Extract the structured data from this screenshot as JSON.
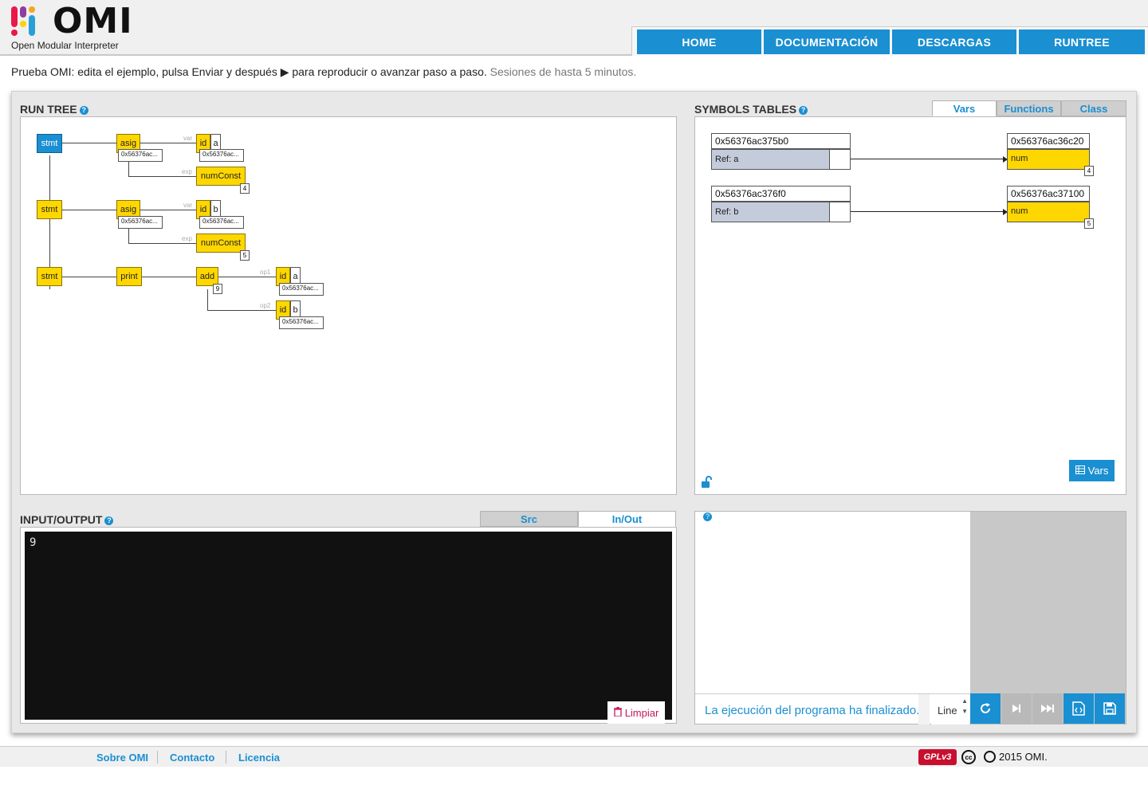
{
  "header": {
    "logo_word": "OMI",
    "logo_subtitle": "Open Modular Interpreter",
    "logo_colors": [
      "#e8194a",
      "#f5a623",
      "#2a9fd6",
      "#8b3fa0",
      "#ffd200"
    ],
    "nav": [
      "HOME",
      "DOCUMENTACIÓN",
      "DESCARGAS",
      "RUNTREE"
    ]
  },
  "intro": {
    "main": "Prueba OMI: edita el ejemplo, pulsa Enviar y después ▶ para reproducir o avanzar paso a paso.",
    "muted": "Sesiones de hasta 5 minutos."
  },
  "run_tree": {
    "title": "RUN TREE",
    "help": "?",
    "rows": [
      {
        "stmt": "stmt",
        "stmt_active": true,
        "op": "asig",
        "op_ref": "0x56376ac...",
        "var_label": "var",
        "id": "id",
        "id_name": "a",
        "id_ref": "0x56376ac...",
        "exp_label": "exp",
        "const": "numConst",
        "const_value": "4"
      },
      {
        "stmt": "stmt",
        "stmt_active": false,
        "op": "asig",
        "op_ref": "0x56376ac...",
        "var_label": "var",
        "id": "id",
        "id_name": "b",
        "id_ref": "0x56376ac...",
        "exp_label": "exp",
        "const": "numConst",
        "const_value": "5"
      }
    ],
    "print_row": {
      "stmt": "stmt",
      "print": "print",
      "add": "add",
      "add_value": "9",
      "op1_label": "op1",
      "op1_id": "id",
      "op1_name": "a",
      "op1_ref": "0x56376ac...",
      "op2_label": "op2",
      "op2_id": "id",
      "op2_name": "b",
      "op2_ref": "0x56376ac..."
    }
  },
  "symbols": {
    "title": "SYMBOLS TABLES",
    "help": "?",
    "tabs": [
      "Vars",
      "Functions",
      "Class"
    ],
    "active_tab": "Vars",
    "entries": [
      {
        "address": "0x56376ac375b0",
        "ref": "Ref: a",
        "target_address": "0x56376ac36c20",
        "type": "num",
        "value": "4"
      },
      {
        "address": "0x56376ac376f0",
        "ref": "Ref: b",
        "target_address": "0x56376ac37100",
        "type": "num",
        "value": "5"
      }
    ],
    "vars_button": "Vars",
    "lock_icon": "unlock-icon"
  },
  "io": {
    "title": "INPUT/OUTPUT",
    "help": "?",
    "tabs": [
      "Src",
      "In/Out"
    ],
    "active_tab": "In/Out",
    "output": "9",
    "clear_button": "Limpiar"
  },
  "debug": {
    "help": "?",
    "status": "La ejecución del programa ha finalizado.",
    "select_value": "Line",
    "controls": [
      {
        "icon": "reload-icon",
        "color": "blue"
      },
      {
        "icon": "step-icon",
        "color": "gray"
      },
      {
        "icon": "fast-forward-icon",
        "color": "gray"
      },
      {
        "icon": "code-icon",
        "color": "blue"
      },
      {
        "icon": "save-icon",
        "color": "blue"
      }
    ]
  },
  "footer": {
    "links": [
      "Sobre OMI",
      "Contacto",
      "Licencia"
    ],
    "gpl": "GPLv3",
    "copyright": "2015 OMI."
  },
  "colors": {
    "accent": "#1a8fd1",
    "node": "#ffd700",
    "ref": "#c4cbdb",
    "clear": "#c3175a"
  }
}
